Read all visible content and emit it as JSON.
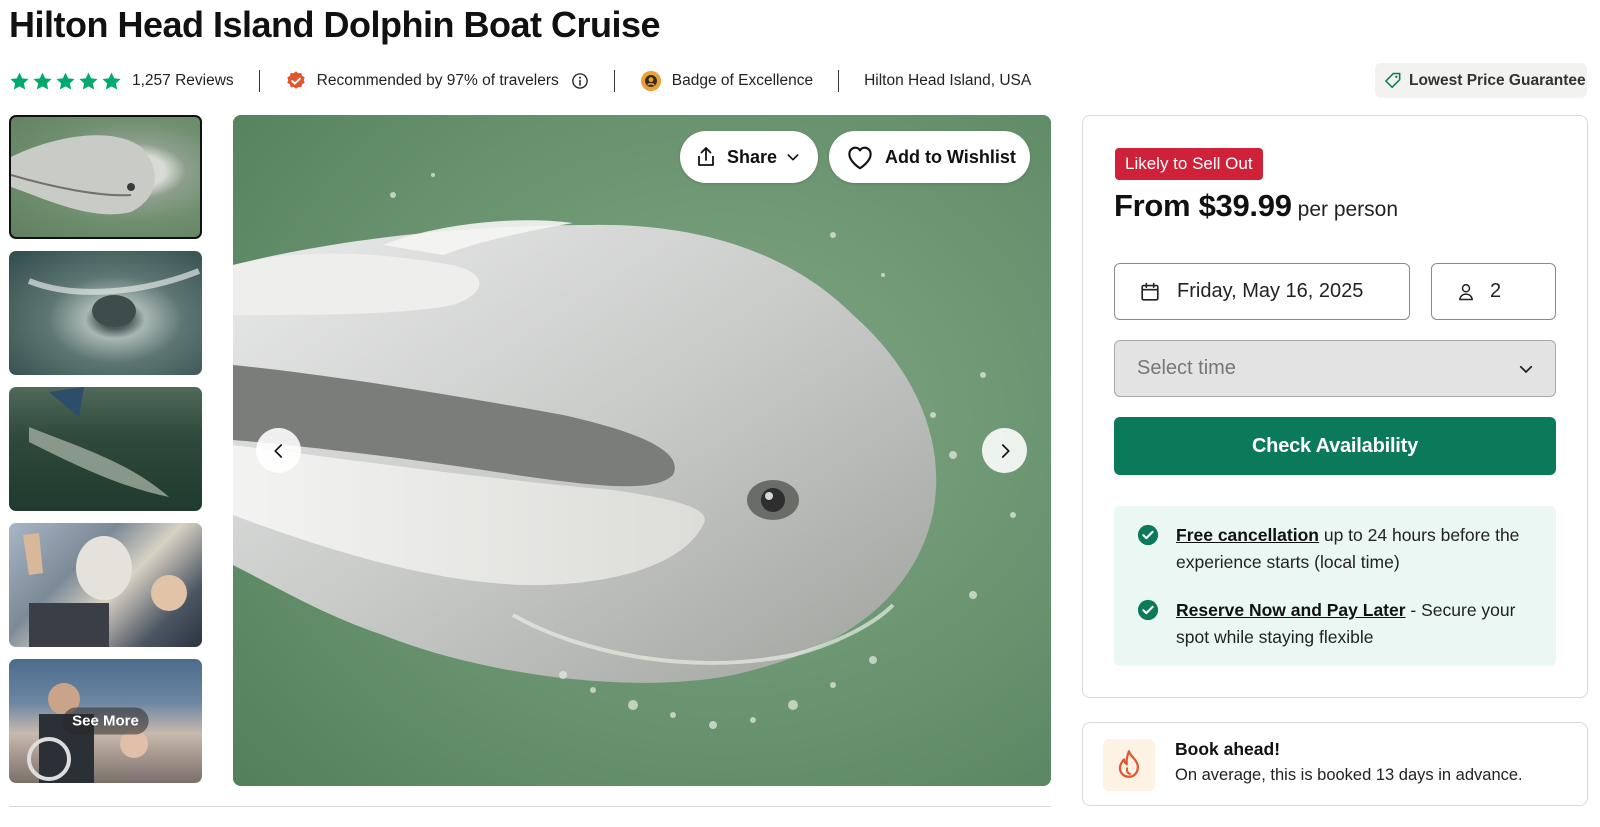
{
  "title": "Hilton Head Island Dolphin Boat Cruise",
  "meta": {
    "rating_stars": 5,
    "reviews": "1,257 Reviews",
    "recommended": "Recommended by 97% of travelers",
    "badge": "Badge of Excellence",
    "location": "Hilton Head Island, USA"
  },
  "lowest_price_guarantee": "Lowest Price Guarantee",
  "gallery": {
    "see_more": "See More",
    "share_label": "Share",
    "wishlist_label": "Add to Wishlist",
    "thumbnails": [
      "dolphin-close-up",
      "dolphin-in-wake",
      "dolphin-underwater",
      "passengers-waving",
      "boat-captain"
    ],
    "active_index": 0
  },
  "booking": {
    "badge": "Likely to Sell Out",
    "price": "From $39.99",
    "price_suffix": "per person",
    "date": "Friday, May 16, 2025",
    "travelers": "2",
    "time_placeholder": "Select time",
    "cta": "Check Availability",
    "perks": [
      {
        "link": "Free cancellation",
        "text": " up to 24 hours before the experience starts (local time)"
      },
      {
        "link": "Reserve Now and Pay Later",
        "text": " - Secure your spot while staying flexible"
      }
    ]
  },
  "book_ahead": {
    "title": "Book ahead!",
    "subtitle": "On average, this is booked 13 days in advance."
  },
  "colors": {
    "star": "#00aa6c",
    "primary_button": "#0b7a5a",
    "sell_out_badge": "#d0213a",
    "perks_bg": "#ebf7f3",
    "check": "#0b7a5a"
  }
}
